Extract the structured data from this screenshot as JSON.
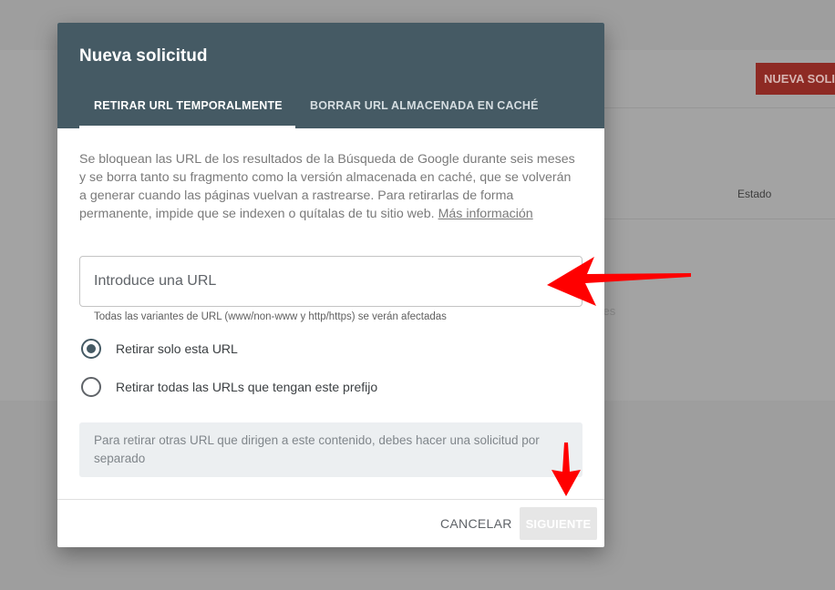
{
  "background": {
    "new_request_button": "NUEVA SOLICITUD",
    "column_status": "Estado",
    "faded_text": "ses"
  },
  "dialog": {
    "title": "Nueva solicitud",
    "tabs": [
      {
        "label": "RETIRAR URL TEMPORALMENTE",
        "active": true
      },
      {
        "label": "BORRAR URL ALMACENADA EN CACHÉ",
        "active": false
      }
    ],
    "description": "Se bloquean las URL de los resultados de la Búsqueda de Google durante seis meses y se borra tanto su fragmento como la versión almacenada en caché, que se volverán a generar cuando las páginas vuelvan a rastrearse. Para retirarlas de forma permanente, impide que se indexen o quítalas de tu sitio web.",
    "more_info_link": "Más información",
    "url_input": {
      "placeholder": "Introduce una URL",
      "value": "",
      "hint": "Todas las variantes de URL (www/non-www y http/https) se verán afectadas"
    },
    "radio_options": [
      {
        "label": "Retirar solo esta URL",
        "checked": true
      },
      {
        "label": "Retirar todas las URLs que tengan este prefijo",
        "checked": false
      }
    ],
    "notice": "Para retirar otras URL que dirigen a este contenido, debes hacer una solicitud por separado",
    "buttons": {
      "cancel": "CANCELAR",
      "next": "SIGUIENTE",
      "next_enabled": false
    }
  },
  "colors": {
    "header": "#455a64",
    "annotation_arrow": "#ff0000",
    "overlay": "#9e9e9e"
  },
  "annotations": [
    {
      "name": "arrow-pointing-url-input",
      "icon": "arrow-left-icon"
    },
    {
      "name": "arrow-pointing-next-button",
      "icon": "arrow-down-icon"
    }
  ]
}
